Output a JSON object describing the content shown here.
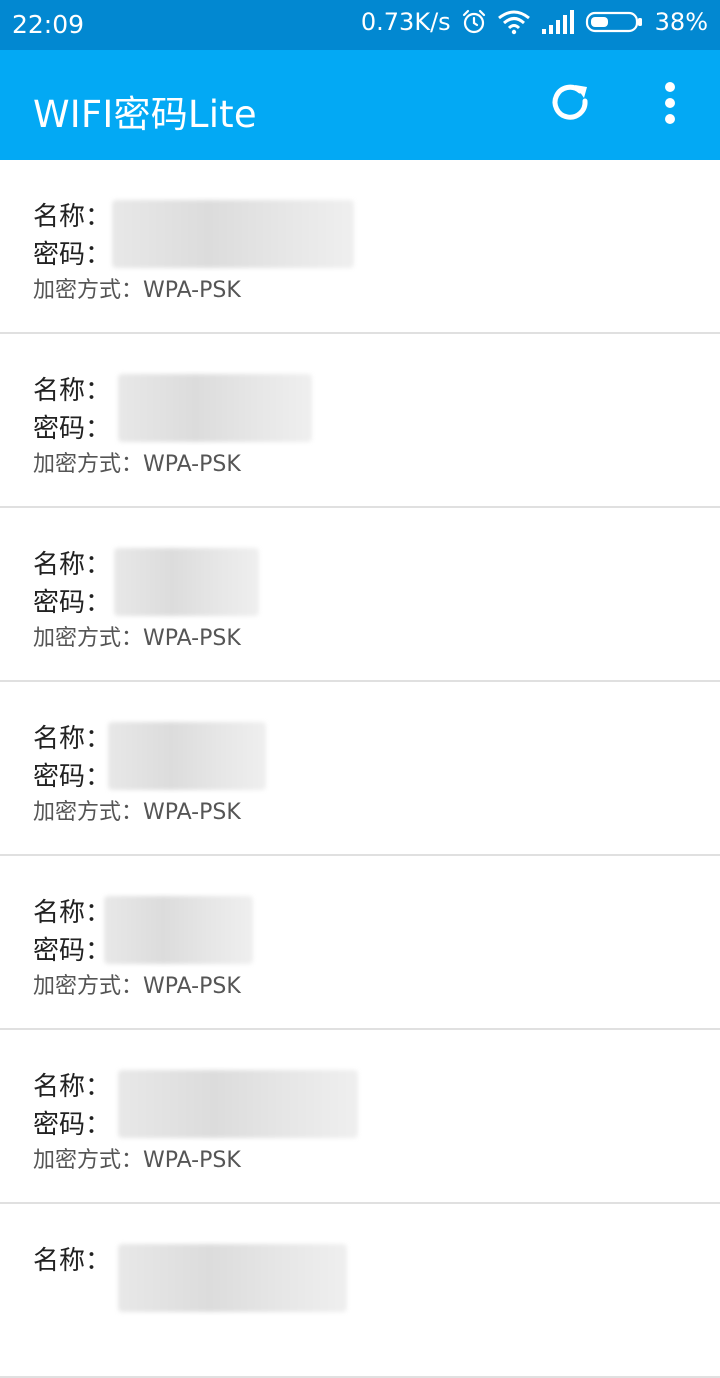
{
  "status_bar": {
    "time": "22:09",
    "net_speed": "0.73K/s",
    "battery": "38%",
    "icons": [
      "alarm-icon",
      "wifi-icon",
      "signal-icon",
      "battery-icon"
    ]
  },
  "app_bar": {
    "title": "WIFI密码Lite",
    "actions": [
      "refresh-icon",
      "overflow-menu-icon"
    ]
  },
  "labels": {
    "name": "名称：",
    "password": "密码：",
    "encryption": "加密方式：WPA-PSK"
  },
  "networks": [
    {
      "encryption": "加密方式：WPA-PSK"
    },
    {
      "encryption": "加密方式：WPA-PSK"
    },
    {
      "encryption": "加密方式：WPA-PSK"
    },
    {
      "encryption": "加密方式：WPA-PSK"
    },
    {
      "encryption": "加密方式：WPA-PSK"
    },
    {
      "encryption": "加密方式：WPA-PSK"
    },
    {
      "encryption": ""
    }
  ],
  "colors": {
    "status_bar": "#0288d1",
    "app_bar": "#03a9f4",
    "divider": "#e0e0e0"
  }
}
